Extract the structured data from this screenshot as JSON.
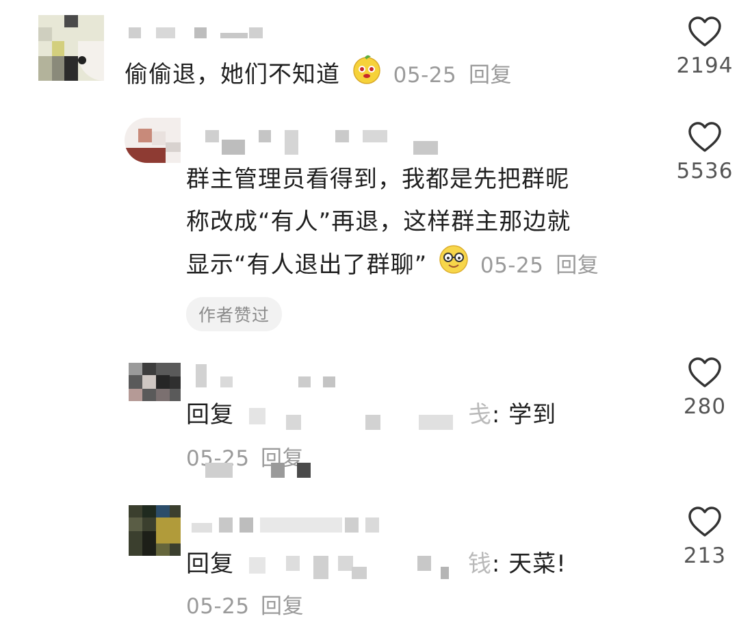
{
  "comments": [
    {
      "text": "偷偷退，她们不知道",
      "date": "05-25",
      "reply_label": "回复",
      "likes": "2194",
      "emoji": "orange-face-emoji"
    },
    {
      "text_lines": [
        "群主管理员看得到，我都是先把群昵",
        "称改成“有人”再退，这样群主那边就",
        "显示“有人退出了群聊”"
      ],
      "date": "05-25",
      "reply_label": "回复",
      "likes": "5536",
      "badge": "作者赞过",
      "emoji": "glasses-face-emoji"
    },
    {
      "reply_prefix": "回复",
      "reply_target_partial": "戋",
      "reply_sep": ":",
      "text": "学到",
      "date": "05-25",
      "reply_label": "回复",
      "likes": "280"
    },
    {
      "reply_prefix": "回复",
      "reply_target_partial": "钱",
      "reply_sep": ":",
      "text": "天菜!",
      "date": "05-25",
      "reply_label": "回复",
      "likes": "213"
    }
  ],
  "icons": {
    "like": "heart-outline-icon"
  },
  "colors": {
    "text": "#1f1f1f",
    "meta": "#9a9a9a",
    "badge_bg": "#f2f2f2"
  }
}
